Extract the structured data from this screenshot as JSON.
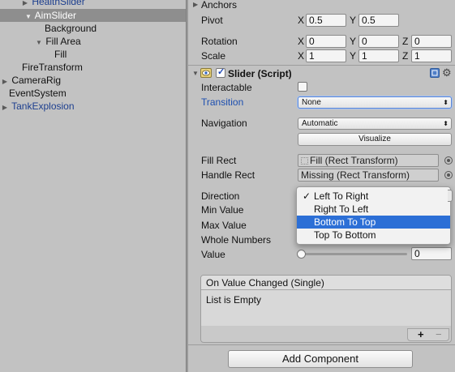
{
  "hierarchy": {
    "items": [
      {
        "label": "HealthSlider",
        "arrow": "▶",
        "blue": true
      },
      {
        "label": "AimSlider",
        "arrow": "▼",
        "selected": true
      },
      {
        "label": "Background"
      },
      {
        "label": "Fill Area",
        "arrow": "▼"
      },
      {
        "label": "Fill"
      },
      {
        "label": "FireTransform"
      },
      {
        "label": "CameraRig",
        "arrow": "▶"
      },
      {
        "label": "EventSystem"
      },
      {
        "label": "TankExplosion",
        "arrow": "▶",
        "blue": true
      }
    ]
  },
  "inspector": {
    "anchors_label": "Anchors",
    "anchors_arrow": "▶",
    "pivot": {
      "label": "Pivot",
      "x_axis": "X",
      "x": "0.5",
      "y_axis": "Y",
      "y": "0.5"
    },
    "rotation": {
      "label": "Rotation",
      "x_axis": "X",
      "x": "0",
      "y_axis": "Y",
      "y": "0",
      "z_axis": "Z",
      "z": "0"
    },
    "scale": {
      "label": "Scale",
      "x_axis": "X",
      "x": "1",
      "y_axis": "Y",
      "y": "1",
      "z_axis": "Z",
      "z": "1"
    },
    "component": {
      "arrow": "▼",
      "title": "Slider (Script)",
      "enabled": true,
      "help_icon": "book-icon",
      "settings_icon": "gear-icon",
      "interactable_label": "Interactable",
      "interactable": false,
      "transition_label": "Transition",
      "transition_value": "None",
      "navigation_label": "Navigation",
      "navigation_value": "Automatic",
      "visualize_label": "Visualize",
      "fill_rect_label": "Fill Rect",
      "fill_rect_value": "Fill (Rect Transform)",
      "handle_rect_label": "Handle Rect",
      "handle_rect_value": "Missing (Rect Transform)",
      "direction_label": "Direction",
      "min_value_label": "Min Value",
      "max_value_label": "Max Value",
      "whole_numbers_label": "Whole Numbers",
      "value_label": "Value",
      "value": "0",
      "slider_fraction": 0
    },
    "direction_popup": {
      "options": [
        "Left To Right",
        "Right To Left",
        "Bottom To Top",
        "Top To Bottom"
      ],
      "checked_index": 0,
      "highlighted_index": 2,
      "check_mark": "✓"
    },
    "event": {
      "header": "On Value Changed (Single)",
      "body": "List is Empty",
      "plus": "+",
      "minus": "−"
    },
    "add_component_label": "Add Component"
  },
  "colors": {
    "background": "#c2c2c2",
    "selection": "#8e8e8e",
    "highlight": "#2c6fd6",
    "link_blue": "#1d3f8f"
  }
}
